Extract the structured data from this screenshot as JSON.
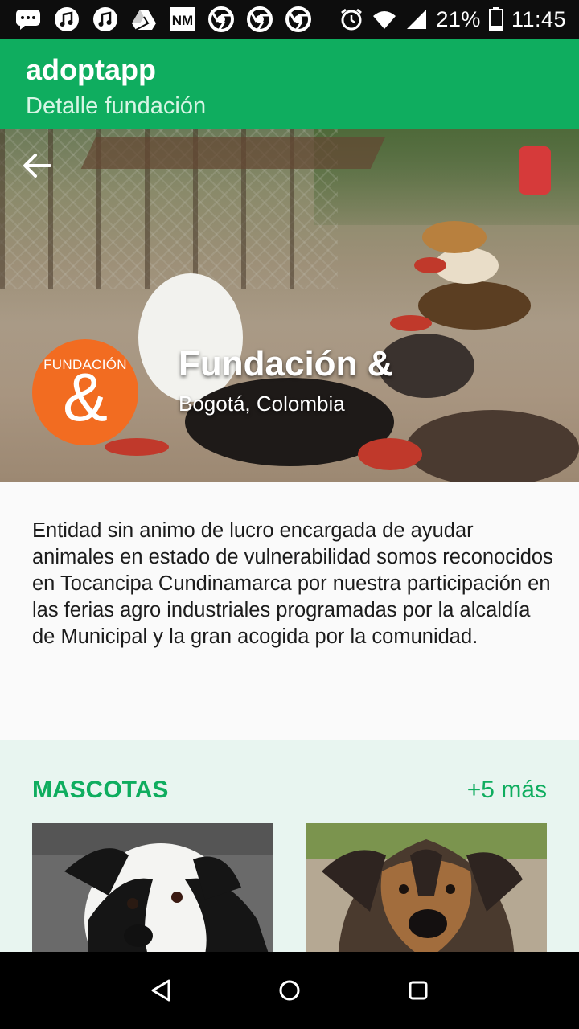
{
  "status_bar": {
    "battery": "21%",
    "time": "11:45",
    "notification_icons": [
      "chat-icon",
      "music-icon",
      "music-icon",
      "drive-icon",
      "nm-icon",
      "chrome-icon",
      "chrome-icon",
      "chrome-icon"
    ]
  },
  "appbar": {
    "title": "adoptapp",
    "subtitle": "Detalle fundación"
  },
  "hero": {
    "logo_text": "FUNDACIÓN",
    "logo_symbol": "&",
    "name": "Fundación &",
    "location": "Bogotá, Colombia"
  },
  "description": "Entidad sin animo de lucro encargada de ayudar animales en estado de vulnerabilidad somos reconocidos en Tocancipa Cundinamarca por nuestra participación en las ferias agro industriales programadas por la alcaldía de Municipal y la gran acogida por la comunidad.",
  "pets": {
    "heading": "MASCOTAS",
    "more": "+5 más"
  },
  "colors": {
    "primary": "#0fad5f",
    "logo": "#f26c21",
    "pets_background": "#e8f5f0"
  }
}
